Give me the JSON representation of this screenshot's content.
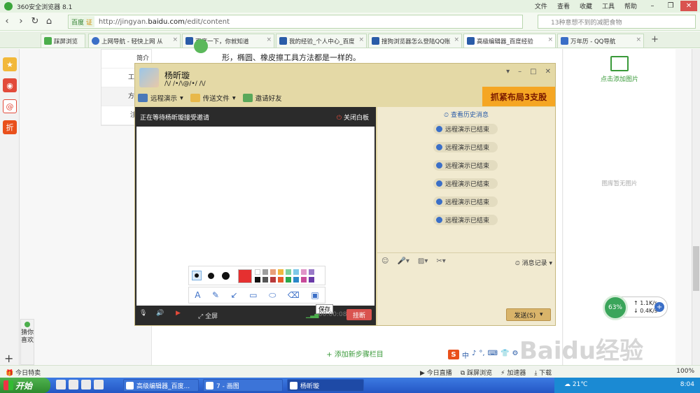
{
  "browser": {
    "title": "360安全浏览器 8.1",
    "menu": [
      "文件",
      "查看",
      "收藏",
      "工具",
      "帮助"
    ],
    "address_badge": "百度",
    "address_badge2": "证",
    "url_prefix": "http://jingyan.",
    "url_domain": "baidu.com",
    "url_path": "/edit/content",
    "search_placeholder": "13种意想不到的减肥食物",
    "tabs": [
      {
        "label": "踩屏浏览",
        "color": "#4cae4c"
      },
      {
        "label": "上网导航 - 轻快上网 从",
        "color": "#3b6fc7"
      },
      {
        "label": "百度一下，你就知道",
        "color": "#2a5ca8"
      },
      {
        "label": "我的经验_个人中心_百度",
        "color": "#2a5ca8"
      },
      {
        "label": "搜狗浏览器怎么登陆QQ账",
        "color": "#2a5ca8"
      },
      {
        "label": "高级编辑器_百度经验",
        "color": "#2a5ca8"
      },
      {
        "label": "万年历 - QQ导航",
        "color": "#3b6fc7"
      }
    ]
  },
  "page": {
    "nav": [
      "简介",
      "工具/原",
      "方法/步",
      "注意事"
    ],
    "text_line": "形，椭圆、橡皮擦工具方法都是一样的。",
    "add_step": "+ 添加新步骤栏目",
    "add_image": "点击添加图片",
    "no_image": "图库暂无图片",
    "guess": "猜你喜欢"
  },
  "qq": {
    "name": "杨昕璇",
    "signature": "/\\/ /•/\\@/•/ /\\/",
    "banner": "抓紧布局3支股",
    "tools": [
      "远程演示",
      "传送文件",
      "邀请好友"
    ],
    "waiting": "正在等待杨昕璇接受邀请",
    "close_board": "关闭白板",
    "save_tip": "保存",
    "fullscreen": "全屏",
    "timer": "00:00:08",
    "hangup": "挂断",
    "history": "查看历史消息",
    "messages": [
      "远程演示已结束",
      "远程演示已结束",
      "远程演示已结束",
      "远程演示已结束",
      "远程演示已结束",
      "远程演示已结束"
    ],
    "msg_record": "消息记录",
    "send": "发送(S)",
    "palette_colors": [
      "#ffffff",
      "#9e9e9e",
      "#e9a07a",
      "#f0b840",
      "#7fd0a0",
      "#7ec8e8",
      "#e095c8",
      "#9a7ac8",
      "#111111",
      "#555555",
      "#b83a3a",
      "#e85a2a",
      "#2aa84a",
      "#2a88c8",
      "#c84a9a",
      "#6a3aa8"
    ],
    "selected_color": "#e53030"
  },
  "speed": {
    "percent": "63%",
    "up": "1.1K/s",
    "down": "0.4K/s"
  },
  "watermark": "Baidu经验",
  "ime": [
    "中",
    "♪",
    "°,",
    "⌨",
    "👕",
    "⚙"
  ],
  "statusbar": {
    "left": "今日特卖",
    "items": [
      "今日直播",
      "踩屏浏览",
      "",
      "",
      "",
      "",
      "加速器",
      "",
      "下载"
    ],
    "zoom": "100%"
  },
  "taskbar": {
    "start": "开始",
    "buttons": [
      "高级编辑器_百度...",
      "7 - 画图",
      "杨昕璇"
    ],
    "temperature": "21℃",
    "time": "8:04"
  }
}
